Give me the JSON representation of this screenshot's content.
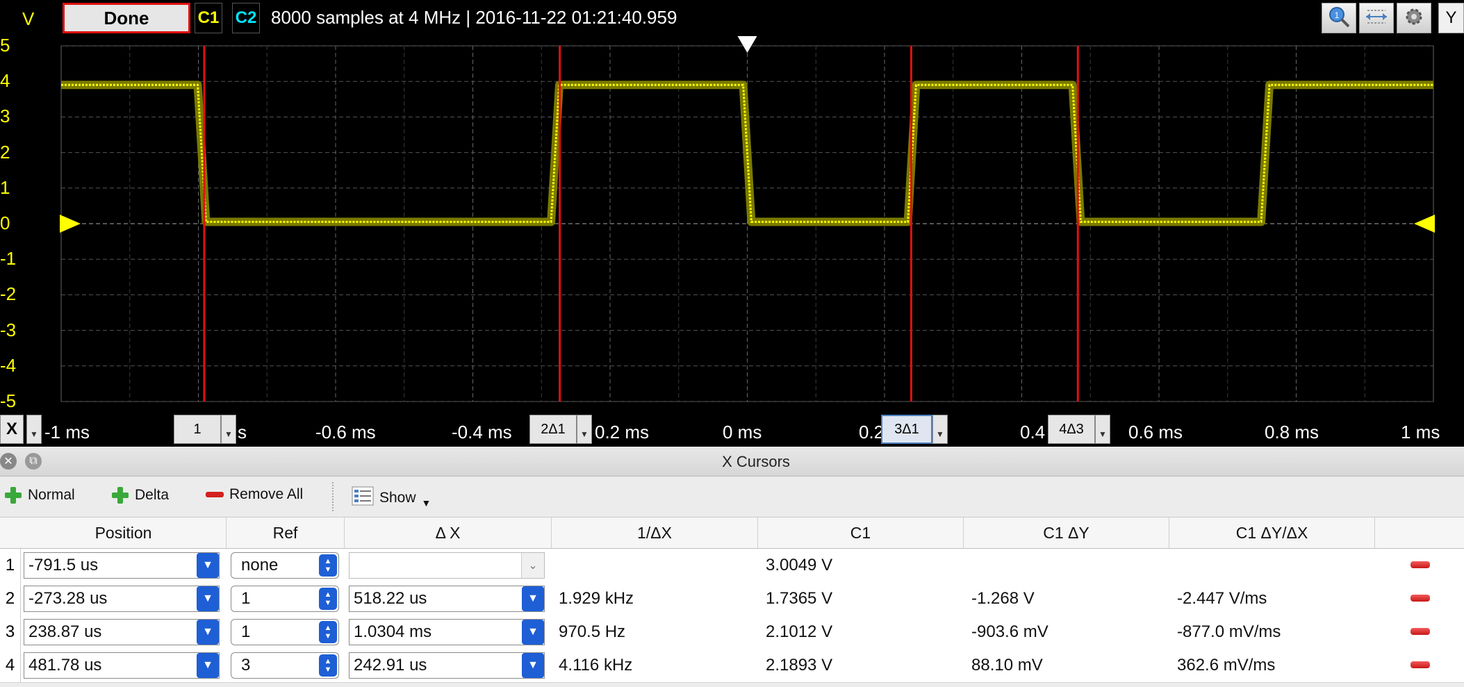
{
  "scope": {
    "unit_label": "V",
    "done_label": "Done",
    "channels": [
      {
        "label": "C1",
        "color": "#ffff00"
      },
      {
        "label": "C2",
        "color": "#00e5ff"
      }
    ],
    "info": "8000 samples at 4 MHz | 2016-11-22 01:21:40.959",
    "toolbar_icons": [
      "zoom-icon",
      "fit-icon",
      "settings-icon"
    ],
    "y_button": "Y",
    "x_button": "X",
    "y_ticks": [
      "5",
      "4",
      "3",
      "2",
      "1",
      "0",
      "-1",
      "-2",
      "-3",
      "-4",
      "-5"
    ],
    "x_ticks": [
      "-1 ms",
      "s",
      "-0.6 ms",
      "-0.4 ms",
      "0.2 ms",
      "0 ms",
      "0.2",
      "0.4 ms",
      "0.6 ms",
      "0.8 ms",
      "1 ms"
    ],
    "cursor_labels": [
      "1",
      "2Δ1",
      "3Δ1",
      "4Δ3"
    ],
    "trace_color": "#ffff00",
    "cursor_color": "#e01010",
    "waveform": {
      "high_level_v": 3.9,
      "low_level_v": 0.05,
      "transitions_ms": [
        -0.795,
        -0.28,
        0.0,
        0.24,
        0.48,
        0.755
      ],
      "start_level": "high"
    },
    "cursor_positions_ms": [
      -0.7915,
      -0.27328,
      0.23887,
      0.48178
    ]
  },
  "panel": {
    "title": "X Cursors",
    "toolbar": {
      "normal": "Normal",
      "delta": "Delta",
      "remove_all": "Remove All",
      "show": "Show"
    },
    "headers": [
      "Position",
      "Ref",
      "Δ X",
      "1/ΔX",
      "C1",
      "C1 ΔY",
      "C1 ΔY/ΔX"
    ],
    "rows": [
      {
        "num": "1",
        "position": "-791.5 us",
        "ref": "none",
        "dx": "",
        "inv_dx": "",
        "c1": "3.0049 V",
        "c1_dy": "",
        "c1_dydx": ""
      },
      {
        "num": "2",
        "position": "-273.28 us",
        "ref": "1",
        "dx": "518.22 us",
        "inv_dx": "1.929 kHz",
        "c1": "1.7365 V",
        "c1_dy": "-1.268 V",
        "c1_dydx": "-2.447 V/ms"
      },
      {
        "num": "3",
        "position": "238.87 us",
        "ref": "1",
        "dx": "1.0304 ms",
        "inv_dx": "970.5 Hz",
        "c1": "2.1012 V",
        "c1_dy": "-903.6 mV",
        "c1_dydx": "-877.0 mV/ms"
      },
      {
        "num": "4",
        "position": "481.78 us",
        "ref": "3",
        "dx": "242.91 us",
        "inv_dx": "4.116 kHz",
        "c1": "2.1893 V",
        "c1_dy": "88.10 mV",
        "c1_dydx": "362.6 mV/ms"
      }
    ]
  }
}
